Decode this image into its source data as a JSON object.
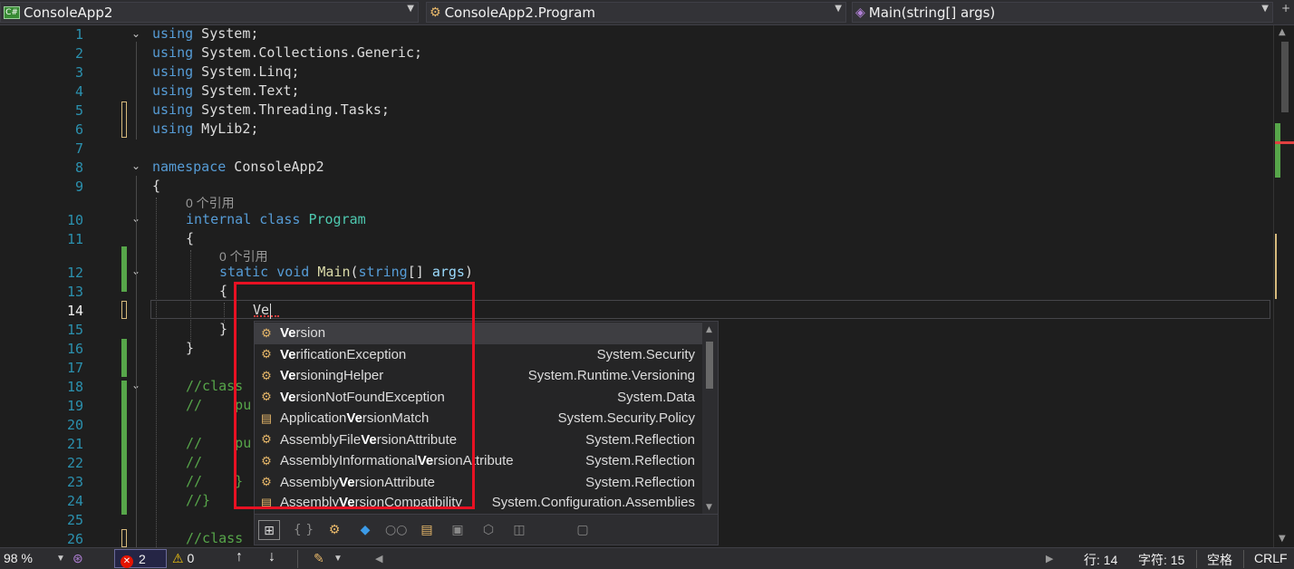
{
  "navbar": {
    "project": "ConsoleApp2",
    "project_icon": "C#",
    "class_path": "ConsoleApp2.Program",
    "member": "Main(string[] args)"
  },
  "editor": {
    "line_numbers": [
      "1",
      "2",
      "3",
      "4",
      "5",
      "6",
      "7",
      "8",
      "9",
      "10",
      "11",
      "12",
      "13",
      "14",
      "15",
      "16",
      "17",
      "18",
      "19",
      "20",
      "21",
      "22",
      "23",
      "24",
      "25",
      "26"
    ],
    "code": {
      "using": "using",
      "l1": " System;",
      "l2": " System.Collections.Generic;",
      "l3": " System.Linq;",
      "l4": " System.Text;",
      "l5": " System.Threading.Tasks;",
      "l6": " MyLib2;",
      "namespace_kw": "namespace",
      "namespace_name": " ConsoleApp2",
      "open_brace": "{",
      "close_brace": "}",
      "internal_kw": "internal",
      "class_kw": " class ",
      "class_name": "Program",
      "static_kw": "static",
      "void_kw": " void ",
      "main_name": "Main",
      "paren_open": "(",
      "string_kw": "string",
      "args_part": "[] ",
      "args_name": "args",
      "paren_close": ")",
      "typed": "Ve",
      "l18": "//class",
      "l19": "//    pu",
      "l21": "//    pu",
      "l22": "//",
      "l23": "//    }",
      "l24": "//}",
      "l26": "//class"
    },
    "lens_1": "0 个引用",
    "lens_2": "0 个引用"
  },
  "completion": {
    "items": [
      {
        "bold": "Ve",
        "pre": "",
        "rest": "rsion",
        "ns": "",
        "icon": "class-icon"
      },
      {
        "bold": "Ve",
        "pre": "",
        "rest": "rificationException",
        "ns": "System.Security",
        "icon": "class-icon"
      },
      {
        "bold": "Ve",
        "pre": "",
        "rest": "rsioningHelper",
        "ns": "System.Runtime.Versioning",
        "icon": "class-icon"
      },
      {
        "bold": "Ve",
        "pre": "",
        "rest": "rsionNotFoundException",
        "ns": "System.Data",
        "icon": "class-icon"
      },
      {
        "bold": "Ve",
        "pre": "Application",
        "rest": "rsionMatch",
        "ns": "System.Security.Policy",
        "icon": "enum-icon"
      },
      {
        "bold": "Ve",
        "pre": "AssemblyFile",
        "rest": "rsionAttribute",
        "ns": "System.Reflection",
        "icon": "class-icon"
      },
      {
        "bold": "Ve",
        "pre": "AssemblyInformational",
        "rest": "rsionAttribute",
        "ns": "System.Reflection",
        "icon": "class-icon"
      },
      {
        "bold": "Ve",
        "pre": "Assembly",
        "rest": "rsionAttribute",
        "ns": "System.Reflection",
        "icon": "class-icon"
      },
      {
        "bold": "Ve",
        "pre": "Assembly",
        "rest": "rsionCompatibility",
        "ns": "System.Configuration.Assemblies",
        "icon": "enum-icon"
      }
    ]
  },
  "status": {
    "zoom": "98 %",
    "errors": "2",
    "warnings": "0",
    "line": "行: 14",
    "col": "字符: 15",
    "spaces": "空格",
    "eol": "CRLF"
  },
  "colors": {
    "keyword": "#569cd6",
    "type": "#4ec9b0",
    "comment": "#57a64a",
    "line_number": "#2b91af",
    "highlight_box": "#e81123"
  }
}
